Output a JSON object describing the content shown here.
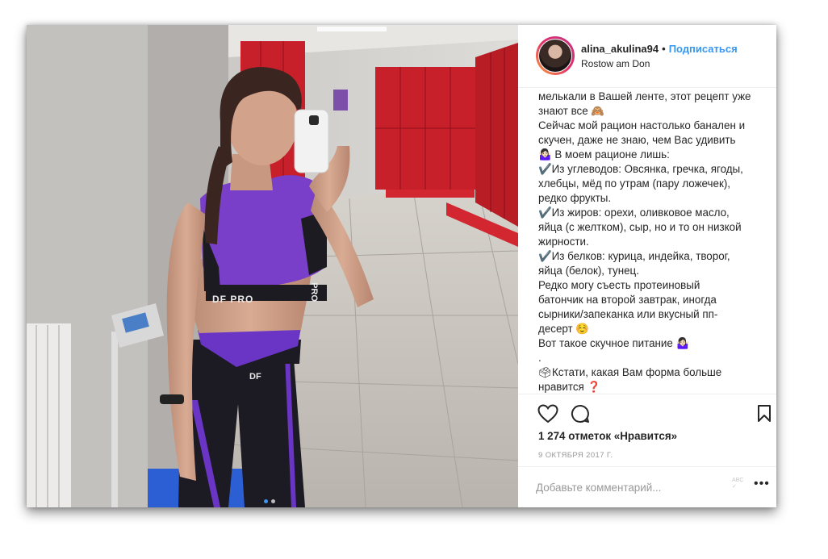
{
  "post": {
    "username": "alina_akulina94",
    "separator": "•",
    "follow_label": "Подписаться",
    "location": "Rostow am Don",
    "caption_lines": [
      "мелькали в Вашей ленте, этот рецепт уже",
      "знают все 🙈",
      "Сейчас мой рацион настолько банален и",
      "скучен, даже не знаю, чем Вас удивить",
      "🤷🏻‍♀️ В моем рационе лишь:",
      "✔️Из углеводов: Овсянка, гречка, ягоды,",
      "хлебцы, мёд по утрам (пару ложечек),",
      "редко фрукты.",
      "✔️Из жиров: орехи, оливковое масло,",
      "яйца (с желтком), сыр, но и то он низкой",
      "жирности.",
      "✔️Из белков: курица, индейка, творог,",
      "яйца (белок), тунец.",
      "Редко могу съесть протеиновый",
      "батончик на второй завтрак, иногда",
      "сырники/запеканка или вкусный пп-",
      "десерт ☺️",
      "Вот такое скучное питание 🤷🏻‍♀️",
      ".",
      "🗳Кстати, какая Вам форма больше",
      "нравится ❓"
    ],
    "likes": "1 274 отметок «Нравится»",
    "date": "9 октября 2017 г.",
    "comment_placeholder": "Добавьте комментарий...",
    "comment_tool": "ABC",
    "more_label": "•••"
  },
  "photo": {
    "top_text": "DF PRO",
    "top_text_side": "PRO",
    "pants_text": "DF"
  },
  "icons": {
    "heart": "heart-icon",
    "comment": "comment-icon",
    "bookmark": "bookmark-icon"
  },
  "colors": {
    "accent": "#3897f0",
    "text": "#262626",
    "muted": "#999999",
    "locker_red": "#c8202a",
    "top_purple": "#7a3fc8"
  }
}
